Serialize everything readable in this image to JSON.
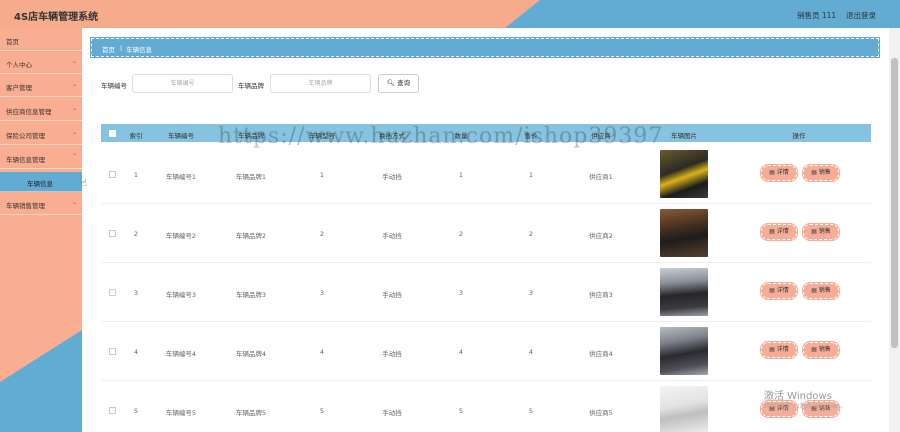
{
  "header": {
    "title": "4S店车辆管理系统",
    "user": "销售员 111",
    "logout": "退出登录"
  },
  "sidebar": {
    "items": [
      {
        "label": "首页"
      },
      {
        "label": "个人中心"
      },
      {
        "label": "客户管理"
      },
      {
        "label": "供应商信息管理"
      },
      {
        "label": "保险公司管理"
      },
      {
        "label": "车辆信息管理"
      },
      {
        "label": "车辆信息"
      },
      {
        "label": "车辆销售管理"
      }
    ]
  },
  "breadcrumb": {
    "home": "首页",
    "sep": "|",
    "current": "车辆信息"
  },
  "search": {
    "field1_label": "车辆编号",
    "field1_placeholder": "车辆编号",
    "field2_label": "车辆品牌",
    "field2_placeholder": "车辆品牌",
    "button": "查询"
  },
  "table": {
    "headers": [
      "索引",
      "车辆编号",
      "车辆品牌",
      "车辆型号",
      "换挡方式",
      "数量",
      "售价",
      "供应商",
      "车辆图片",
      "操作"
    ],
    "rows": [
      {
        "index": "1",
        "code": "车辆编号1",
        "brand": "车辆品牌1",
        "model": "1",
        "shift": "手动挡",
        "qty": "1",
        "price": "1",
        "supplier": "供应商1"
      },
      {
        "index": "2",
        "code": "车辆编号2",
        "brand": "车辆品牌2",
        "model": "2",
        "shift": "手动挡",
        "qty": "2",
        "price": "2",
        "supplier": "供应商2"
      },
      {
        "index": "3",
        "code": "车辆编号3",
        "brand": "车辆品牌3",
        "model": "3",
        "shift": "手动挡",
        "qty": "3",
        "price": "3",
        "supplier": "供应商3"
      },
      {
        "index": "4",
        "code": "车辆编号4",
        "brand": "车辆品牌4",
        "model": "4",
        "shift": "手动挡",
        "qty": "4",
        "price": "4",
        "supplier": "供应商4"
      },
      {
        "index": "5",
        "code": "车辆编号5",
        "brand": "车辆品牌5",
        "model": "5",
        "shift": "手动挡",
        "qty": "5",
        "price": "5",
        "supplier": "供应商5"
      }
    ],
    "detail_label": "详情",
    "sell_label": "销售"
  },
  "watermark": "https://www.huzhan.com/ishop39397",
  "os_notice": {
    "line1": "激活 Windows",
    "line2": "转到\"设置\"以激活 Windows。"
  },
  "colors": {
    "salmon": "#f7ab8d",
    "blue": "#62abd3",
    "table_header": "#86c3e0"
  }
}
